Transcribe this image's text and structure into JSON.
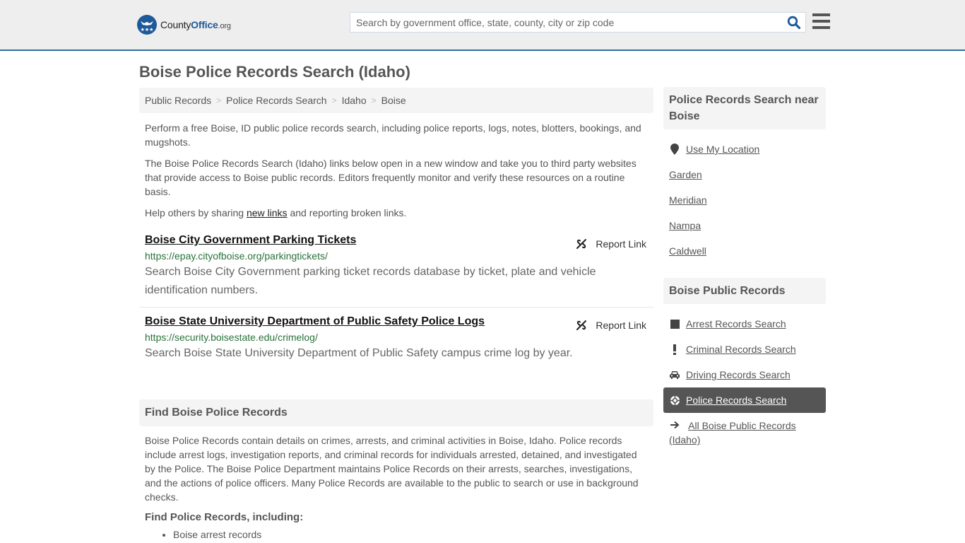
{
  "header": {
    "logo": {
      "county": "County",
      "office": "Office",
      "org": ".org"
    },
    "search_placeholder": "Search by government office, state, county, city or zip code",
    "search_icon": "search-icon",
    "menu_icon": "hamburger-menu-icon"
  },
  "page": {
    "title": "Boise Police Records Search (Idaho)"
  },
  "breadcrumb": [
    {
      "label": "Public Records"
    },
    {
      "label": "Police Records Search"
    },
    {
      "label": "Idaho"
    },
    {
      "label": "Boise"
    }
  ],
  "intro": {
    "p1": "Perform a free Boise, ID public police records search, including police reports, logs, notes, blotters, bookings, and mugshots.",
    "p2": "The Boise Police Records Search (Idaho) links below open in a new window and take you to third party websites that provide access to Boise public records. Editors frequently monitor and verify these resources on a routine basis.",
    "p3_before": "Help others by sharing ",
    "p3_link": "new links",
    "p3_after": " and reporting broken links."
  },
  "results": [
    {
      "title": "Boise City Government Parking Tickets",
      "url": "https://epay.cityofboise.org/parkingtickets/",
      "description": "Search Boise City Government parking ticket records database by ticket, plate and vehicle identification numbers.",
      "report_label": "Report Link"
    },
    {
      "title": "Boise State University Department of Public Safety Police Logs",
      "url": "https://security.boisestate.edu/crimelog/",
      "description": "Search Boise State University Department of Public Safety campus crime log by year.",
      "report_label": "Report Link"
    }
  ],
  "find": {
    "heading": "Find Boise Police Records",
    "text": "Boise Police Records contain details on crimes, arrests, and criminal activities in Boise, Idaho. Police records include arrest logs, investigation reports, and criminal records for individuals arrested, detained, and investigated by the Police. The Boise Police Department maintains Police Records on their arrests, searches, investigations, and the actions of police officers. Many Police Records are available to the public to search or use in background checks.",
    "subheading": "Find Police Records, including:",
    "list": [
      "Boise arrest records"
    ]
  },
  "sidebar": {
    "near_heading": "Police Records Search near Boise",
    "use_location": "Use My Location",
    "nearby": [
      "Garden",
      "Meridian",
      "Nampa",
      "Caldwell"
    ],
    "public_heading": "Boise Public Records",
    "public_items": [
      {
        "label": "Arrest Records Search",
        "icon": "square-icon",
        "active": false
      },
      {
        "label": "Criminal Records Search",
        "icon": "exclamation-icon",
        "active": false
      },
      {
        "label": "Driving Records Search",
        "icon": "car-icon",
        "active": false
      },
      {
        "label": "Police Records Search",
        "icon": "crosshairs-icon",
        "active": true
      },
      {
        "label": "All Boise Public Records (Idaho)",
        "icon": "arrow-right-icon",
        "active": false
      }
    ]
  },
  "colors": {
    "brand_blue": "#1e5a99",
    "header_border": "#2e6da4",
    "url_green": "#287338",
    "active_bg": "#555555"
  }
}
